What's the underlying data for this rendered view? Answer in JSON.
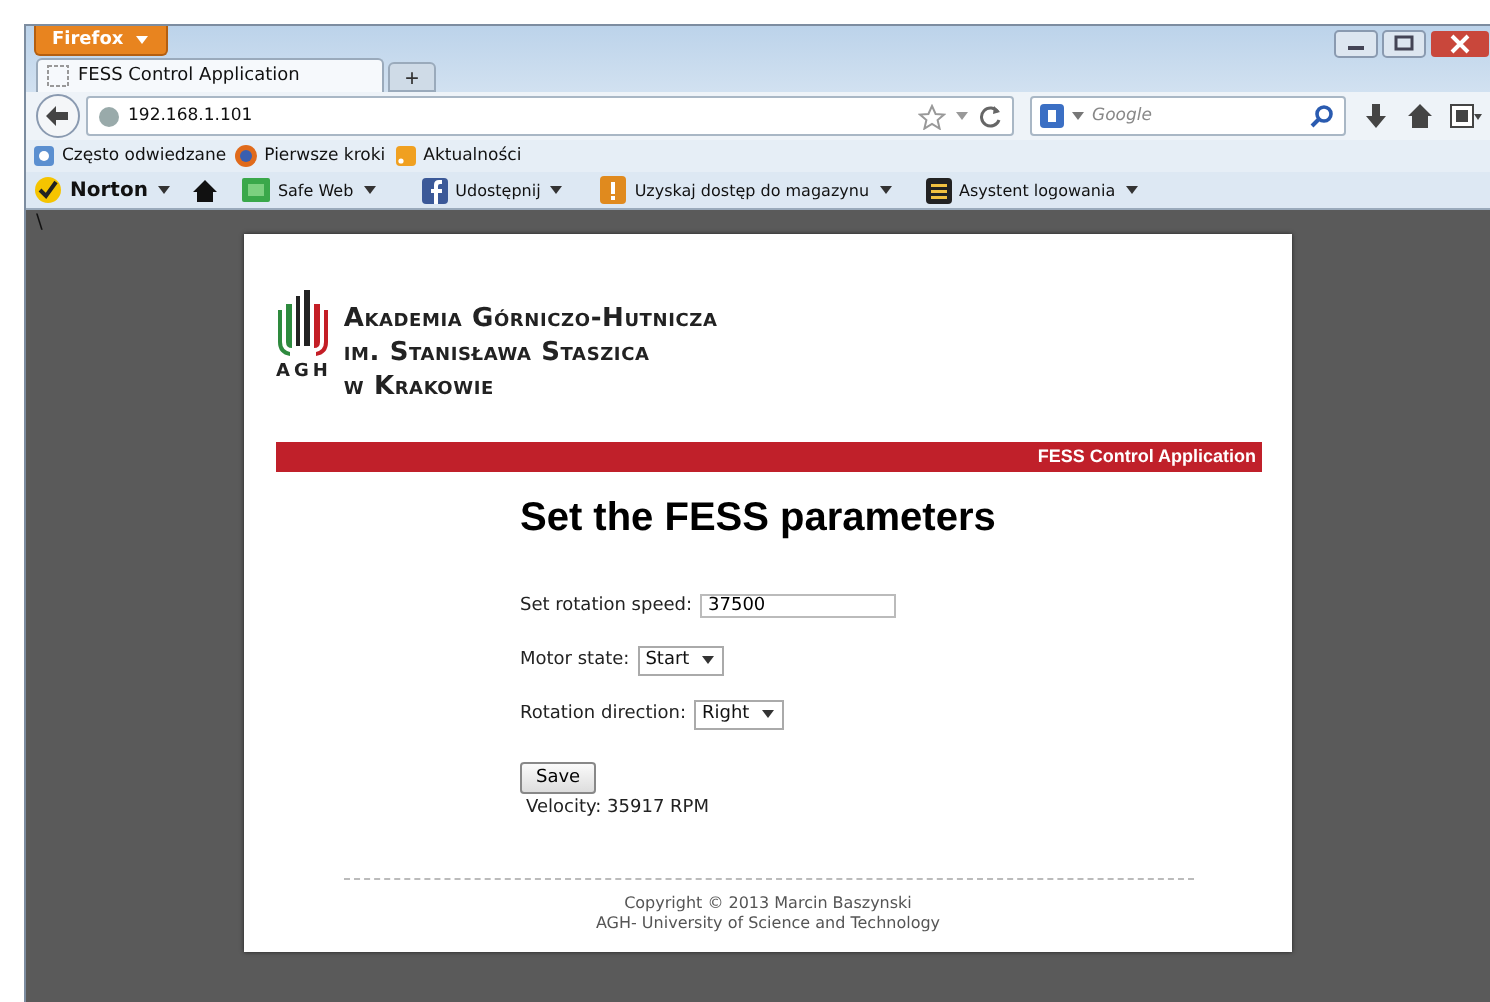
{
  "browser": {
    "app_button": "Firefox",
    "tabs": [
      {
        "title": "FESS Control Application",
        "selected": true
      }
    ],
    "new_tab": "+",
    "address": "192.168.1.101",
    "search": {
      "placeholder": "Google"
    },
    "bookmarks": [
      "Często odwiedzane",
      "Pierwsze kroki",
      "Aktualności"
    ],
    "toolbar": [
      {
        "label": "Norton",
        "kind": "norton"
      },
      {
        "kind": "home"
      },
      {
        "label": "Safe Web",
        "kind": "safeweb"
      },
      {
        "label": "Udostępnij",
        "kind": "facebook"
      },
      {
        "label": "Uzyskaj dostęp do magazynu",
        "kind": "magazine"
      },
      {
        "label": "Asystent logowania",
        "kind": "login"
      }
    ],
    "stray_mark": "\\"
  },
  "page": {
    "logo": {
      "abbr": "AGH",
      "lines": [
        "Akademia Górniczo-Hutnicza",
        "im. Stanisława Staszica",
        "w Krakowie"
      ]
    },
    "banner": "FESS Control Application",
    "heading": "Set the FESS parameters",
    "form": [
      {
        "kind": "text",
        "label": "Set rotation speed:",
        "value": "37500"
      },
      {
        "kind": "select",
        "label": "Motor state:",
        "value": "Start"
      },
      {
        "kind": "select",
        "label": "Rotation direction:",
        "value": "Right"
      }
    ],
    "save": "Save",
    "velocity": "Velocity: 35917 RPM",
    "footer": [
      "Copyright © 2013 Marcin Baszynski",
      "AGH- University of Science and Technology"
    ]
  }
}
